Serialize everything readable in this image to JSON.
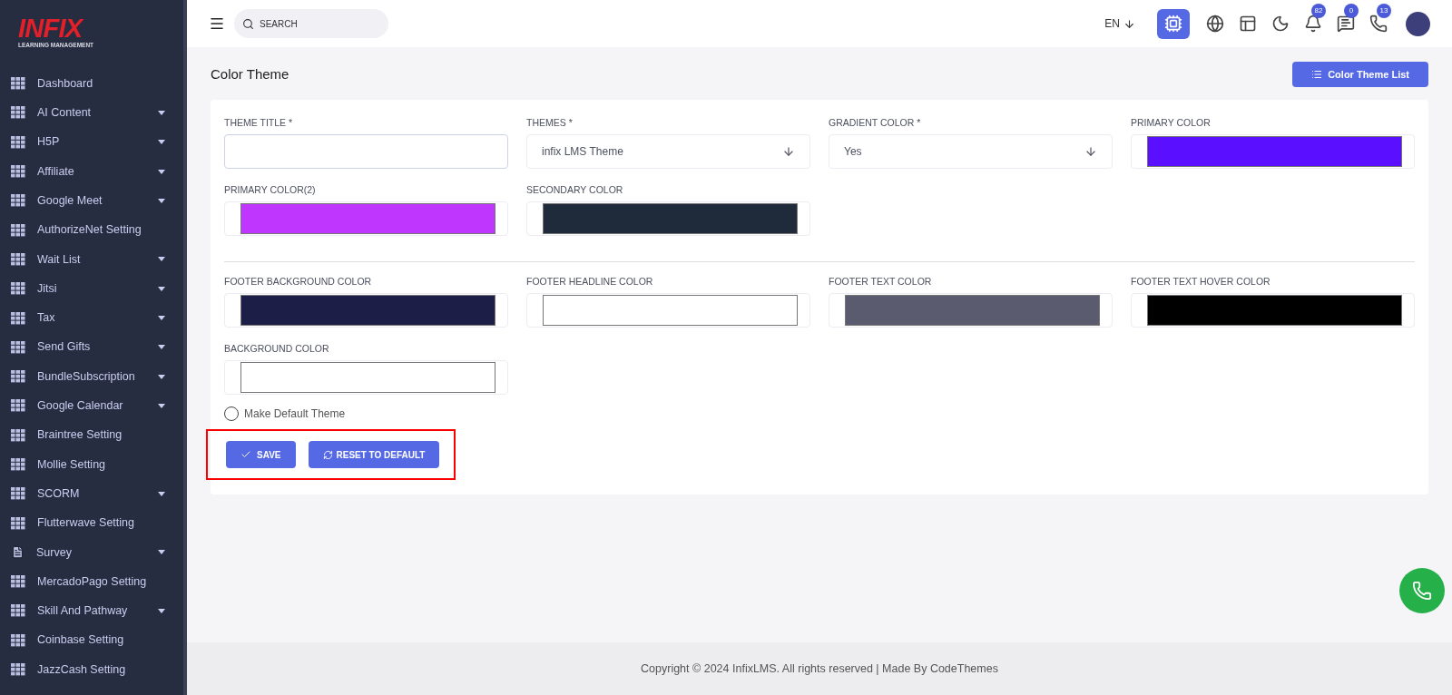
{
  "logo": {
    "brand": "INFIX",
    "tagline": "LEARNING MANAGEMENT"
  },
  "sidebar": {
    "items": [
      {
        "label": "Dashboard",
        "kind": "grid",
        "expandable": false
      },
      {
        "label": "AI Content",
        "kind": "grid",
        "expandable": true
      },
      {
        "label": "H5P",
        "kind": "grid",
        "expandable": true
      },
      {
        "label": "Affiliate",
        "kind": "grid",
        "expandable": true
      },
      {
        "label": "Google Meet",
        "kind": "grid",
        "expandable": true
      },
      {
        "label": "AuthorizeNet Setting",
        "kind": "grid",
        "expandable": false
      },
      {
        "label": "Wait List",
        "kind": "grid",
        "expandable": true
      },
      {
        "label": "Jitsi",
        "kind": "grid",
        "expandable": true
      },
      {
        "label": "Tax",
        "kind": "grid",
        "expandable": true
      },
      {
        "label": "Send Gifts",
        "kind": "grid",
        "expandable": true
      },
      {
        "label": "BundleSubscription",
        "kind": "grid",
        "expandable": true
      },
      {
        "label": "Google Calendar",
        "kind": "grid",
        "expandable": true
      },
      {
        "label": "Braintree Setting",
        "kind": "grid",
        "expandable": false
      },
      {
        "label": "Mollie Setting",
        "kind": "grid",
        "expandable": false
      },
      {
        "label": "SCORM",
        "kind": "grid",
        "expandable": true
      },
      {
        "label": "Flutterwave Setting",
        "kind": "grid",
        "expandable": false
      },
      {
        "label": "Survey",
        "kind": "document",
        "expandable": true
      },
      {
        "label": "MercadoPago Setting",
        "kind": "grid",
        "expandable": false
      },
      {
        "label": "Skill And Pathway",
        "kind": "grid",
        "expandable": true
      },
      {
        "label": "Coinbase Setting",
        "kind": "grid",
        "expandable": false
      },
      {
        "label": "JazzCash Setting",
        "kind": "grid",
        "expandable": false
      }
    ]
  },
  "header": {
    "search": {
      "placeholder": "SEARCH"
    },
    "language": "EN",
    "badges": [
      {
        "kind": "bell",
        "count": "82"
      },
      {
        "kind": "chat",
        "count": "0"
      },
      {
        "kind": "phone",
        "count": "13"
      }
    ]
  },
  "page": {
    "title": "Color Theme",
    "list_button": "Color Theme List"
  },
  "form": {
    "rows": [
      [
        {
          "label": "THEME TITLE *",
          "kind": "text"
        },
        {
          "label": "THEMES *",
          "kind": "select",
          "value": "infix LMS Theme"
        },
        {
          "label": "GRADIENT COLOR *",
          "kind": "select",
          "value": "Yes"
        },
        {
          "label": "PRIMARY COLOR",
          "kind": "color",
          "color": "#5b0fff"
        }
      ],
      [
        {
          "label": "PRIMARY COLOR(2)",
          "kind": "color",
          "color": "#bf37ff"
        },
        {
          "label": "SECONDARY COLOR",
          "kind": "color",
          "color": "#1f2b3a"
        }
      ],
      [
        {
          "label": "FOOTER BACKGROUND COLOR",
          "kind": "color",
          "color": "#1c1e47"
        },
        {
          "label": "FOOTER HEADLINE COLOR",
          "kind": "color",
          "color": "#ffffff"
        },
        {
          "label": "FOOTER TEXT COLOR",
          "kind": "color",
          "color": "#5a5b6e"
        },
        {
          "label": "FOOTER TEXT HOVER COLOR",
          "kind": "color",
          "color": "#000000"
        }
      ],
      [
        {
          "label": "BACKGROUND COLOR",
          "kind": "color",
          "color": "#ffffff"
        }
      ]
    ],
    "make_default": {
      "label": "Make Default Theme",
      "checked": false
    },
    "actions": {
      "highlighted": true,
      "save": "SAVE",
      "reset": "RESET TO DEFAULT"
    }
  },
  "footer": "Copyright © 2024 InfixLMS. All rights reserved | Made By CodeThemes"
}
